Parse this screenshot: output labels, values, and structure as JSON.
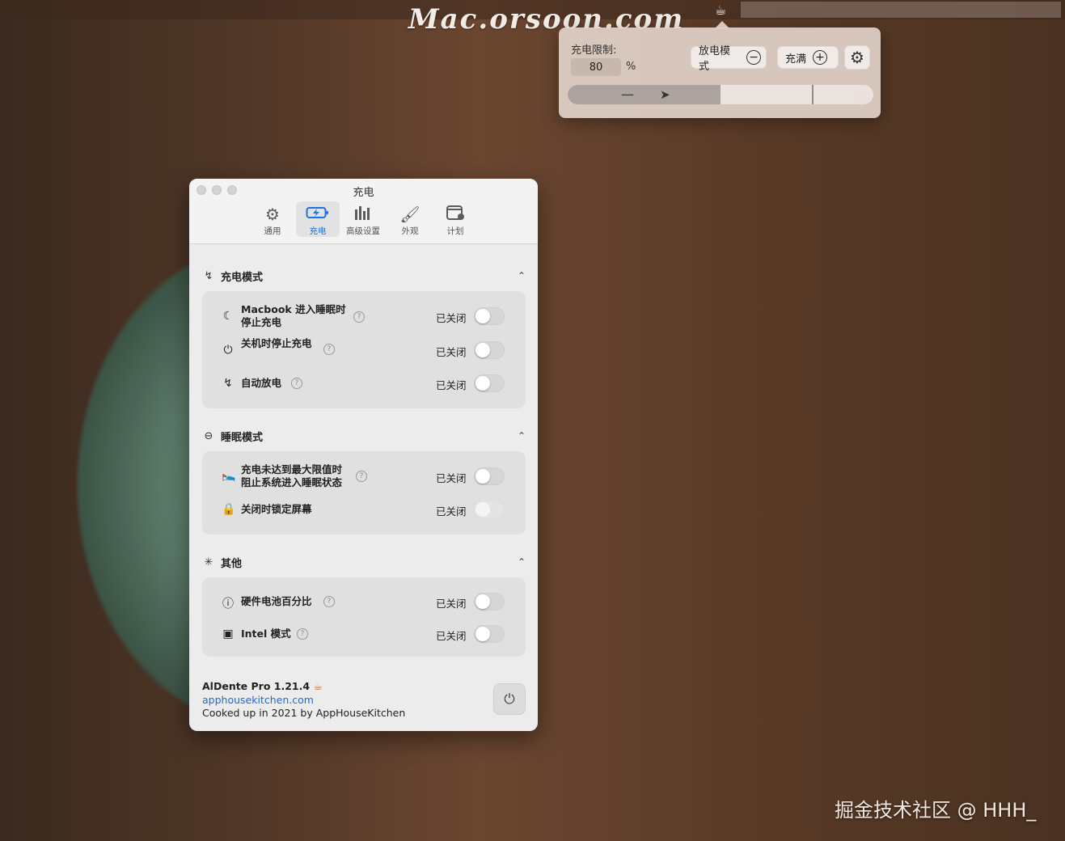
{
  "desktop": {
    "watermark_top": "Mac.orsoon.com",
    "watermark_bottom": "掘金技术社区 @ HHH_"
  },
  "menubar": {
    "app_icon": "aldente-cup-icon"
  },
  "popover": {
    "limit_label": "充电限制:",
    "limit_value": "80",
    "percent_sign": "%",
    "discharge_label": "放电模式",
    "topup_label": "充满",
    "slider_level_percent": 80,
    "slider_fill_percent": 50
  },
  "window": {
    "title": "充电",
    "tabs": [
      {
        "label": "通用",
        "icon": "gear-icon",
        "active": false
      },
      {
        "label": "充电",
        "icon": "battery-charging-icon",
        "active": true
      },
      {
        "label": "高级设置",
        "icon": "bar-chart-icon",
        "active": false
      },
      {
        "label": "外观",
        "icon": "brush-icon",
        "active": false
      },
      {
        "label": "计划",
        "icon": "calendar-icon",
        "active": false
      }
    ],
    "sections": {
      "charging_mode": {
        "title": "充电模式",
        "rows": [
          {
            "line1": "Macbook 进入睡眠时",
            "line2": "停止充电",
            "state": "已关闭",
            "on": false
          },
          {
            "line1": "关机时停止充电",
            "state": "已关闭",
            "on": false
          },
          {
            "line1": "自动放电",
            "state": "已关闭",
            "on": false
          }
        ]
      },
      "sleep_mode": {
        "title": "睡眠模式",
        "rows": [
          {
            "line1": "充电未达到最大限值时",
            "line2": "阻止系统进入睡眠状态",
            "state": "已关闭",
            "on": false
          },
          {
            "line1": "关闭时锁定屏幕",
            "state": "已关闭",
            "on": false,
            "disabled": true
          }
        ]
      },
      "other": {
        "title": "其他",
        "rows": [
          {
            "line1": "硬件电池百分比",
            "state": "已关闭",
            "on": false
          },
          {
            "line1": "Intel 模式",
            "state": "已关闭",
            "on": false
          }
        ]
      }
    },
    "footer": {
      "app_name": "AlDente Pro 1.21.4",
      "link": "apphousekitchen.com",
      "credit": "Cooked up in 2021 by AppHouseKitchen"
    }
  }
}
